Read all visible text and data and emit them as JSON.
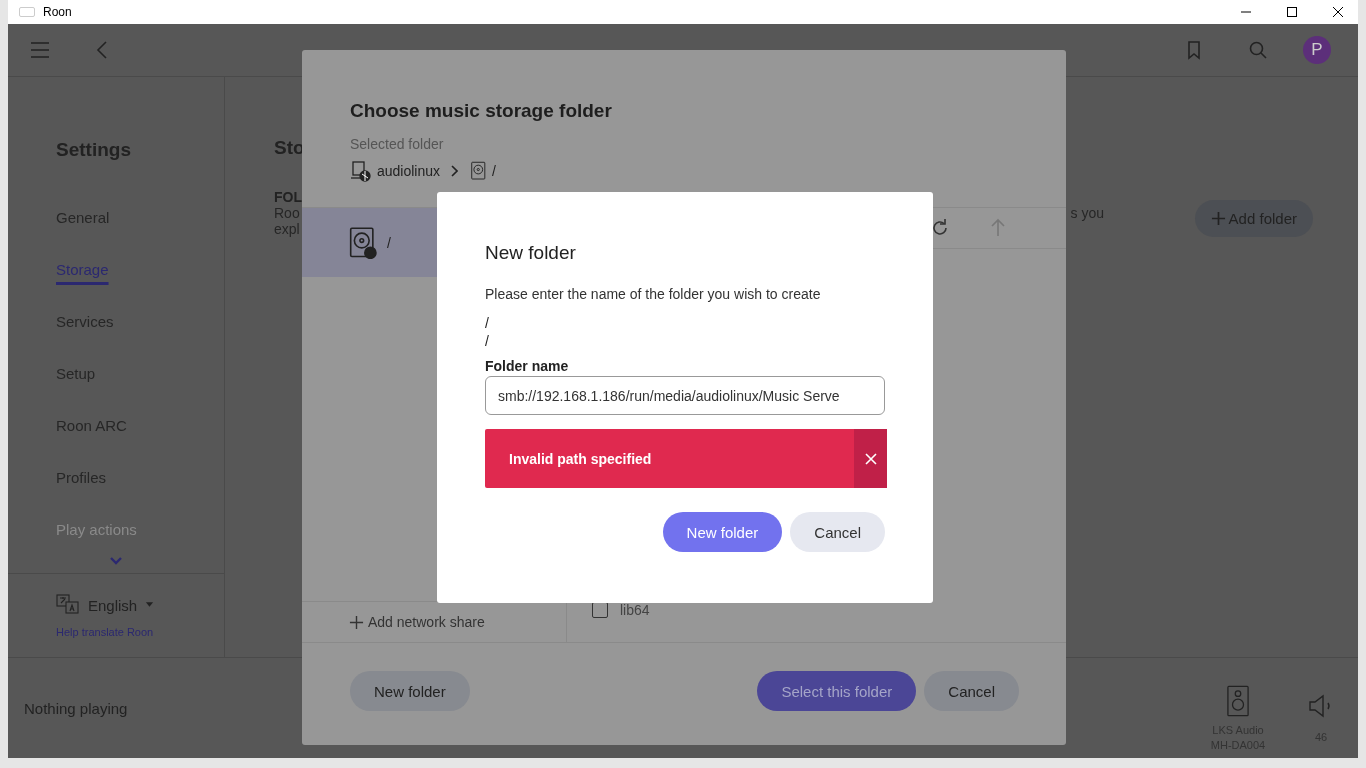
{
  "window": {
    "title": "Roon"
  },
  "topbar": {
    "avatar": "P"
  },
  "sidebar": {
    "title": "Settings",
    "items": [
      {
        "label": "General",
        "selected": false
      },
      {
        "label": "Storage",
        "selected": true
      },
      {
        "label": "Services",
        "selected": false
      },
      {
        "label": "Setup",
        "selected": false
      },
      {
        "label": "Roon ARC",
        "selected": false
      },
      {
        "label": "Profiles",
        "selected": false
      },
      {
        "label": "Play actions",
        "selected": false
      }
    ],
    "language": "English",
    "help_link": "Help translate Roon"
  },
  "background": {
    "heading": "Sto",
    "section_label": "FOL",
    "description_lines": [
      "Roo",
      "expl"
    ],
    "description_tail": "s you",
    "add_button": "Add folder"
  },
  "player": {
    "status": "Nothing playing",
    "zone": "LKS Audio MH-DA004",
    "volume": "46"
  },
  "storage_dialog": {
    "title": "Choose music storage folder",
    "selected_label": "Selected folder",
    "breadcrumb": [
      {
        "label": "audiolinux",
        "kind": "server"
      },
      {
        "label": "/",
        "kind": "drive"
      }
    ],
    "locations": [
      {
        "label": "/",
        "kind": "drive",
        "selected": true
      }
    ],
    "add_share": "Add network share",
    "folders": [
      {
        "name": "lib64",
        "checked": false
      }
    ],
    "buttons": [
      {
        "label": "New folder",
        "kind": "secondary"
      },
      {
        "label": "Select this folder",
        "kind": "primary"
      },
      {
        "label": "Cancel",
        "kind": "secondary"
      }
    ]
  },
  "new_folder_dialog": {
    "title": "New folder",
    "prompt": "Please enter the name of the folder you wish to create",
    "paths": [
      "/",
      "/"
    ],
    "field_label": "Folder name",
    "value": "smb://192.168.1.186/run/media/audiolinux/Music Serve",
    "error": "Invalid path specified",
    "buttons": [
      {
        "label": "New folder",
        "kind": "primary"
      },
      {
        "label": "Cancel",
        "kind": "secondary"
      }
    ]
  }
}
